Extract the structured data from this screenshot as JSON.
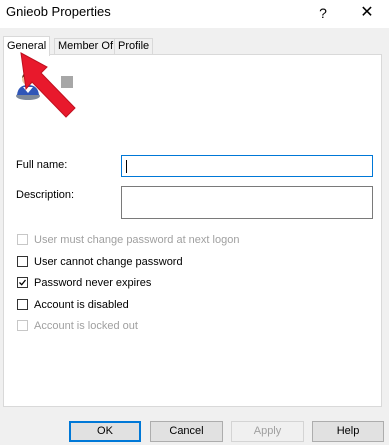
{
  "window": {
    "title": "Gnieob Properties",
    "help_glyph": "?",
    "close_glyph": "✕"
  },
  "tabs": [
    {
      "label": "General",
      "active": true
    },
    {
      "label": "Member Of",
      "active": false
    },
    {
      "label": "Profile",
      "active": false
    }
  ],
  "general": {
    "full_name_label": "Full name:",
    "full_name_value": "",
    "description_label": "Description:",
    "description_value": "",
    "options": [
      {
        "label": "User must change password at next logon",
        "checked": false,
        "enabled": false
      },
      {
        "label": "User cannot change password",
        "checked": false,
        "enabled": true
      },
      {
        "label": "Password never expires",
        "checked": true,
        "enabled": true
      },
      {
        "label": "Account is disabled",
        "checked": false,
        "enabled": true
      },
      {
        "label": "Account is locked out",
        "checked": false,
        "enabled": false
      }
    ]
  },
  "buttons": {
    "ok": "OK",
    "cancel": "Cancel",
    "apply": "Apply",
    "help": "Help"
  },
  "colors": {
    "focus_border": "#0078d7",
    "annotation_arrow": "#e8192c",
    "dialog_background": "#f0f0f0"
  },
  "icons": {
    "user_icon": "user-account-icon",
    "annotation": "red-arrow-annotation"
  }
}
